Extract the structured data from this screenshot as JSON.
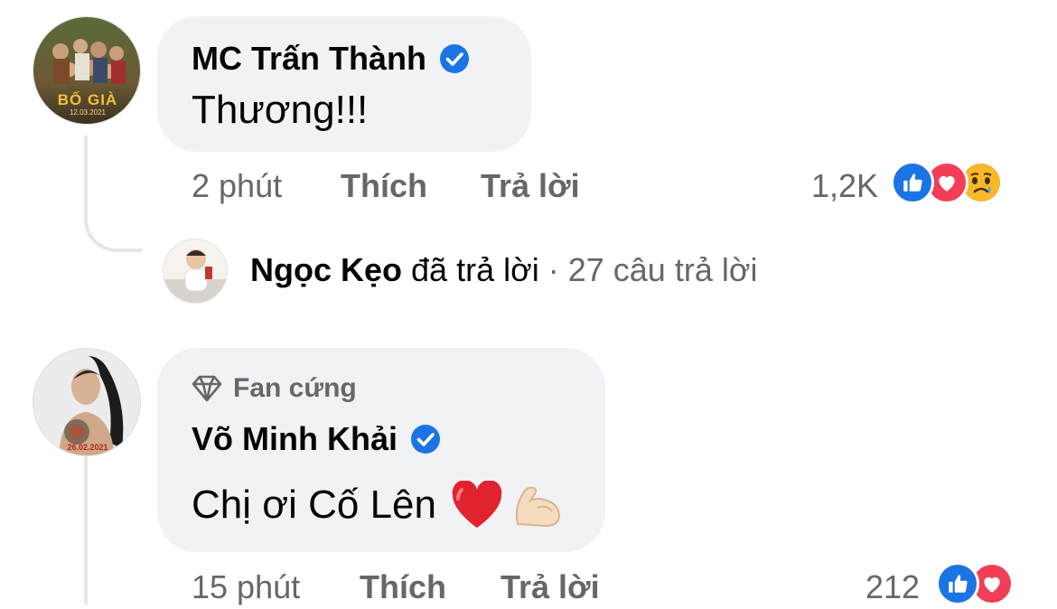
{
  "comments": [
    {
      "author": "MC Trấn Thành",
      "text": "Thương!!!",
      "time": "2 phút",
      "like_label": "Thích",
      "reply_label": "Trả lời",
      "reaction_count": "1,2K",
      "reactions": [
        "like-icon",
        "love-icon",
        "sad-icon"
      ],
      "avatar_text": {
        "title": "BỐ GIÀ",
        "date": "12.03.2021"
      }
    },
    {
      "badge": "Fan cứng",
      "author": "Võ Minh Khải",
      "text": "Chị ơi Cố Lên",
      "emoji": [
        "red-heart",
        "flexed-biceps"
      ],
      "time": "15 phút",
      "like_label": "Thích",
      "reply_label": "Trả lời",
      "reaction_count": "212",
      "reactions": [
        "like-icon",
        "love-icon"
      ],
      "avatar_text": {
        "date": "26.02.2021"
      }
    }
  ],
  "reply_summary": {
    "author": "Ngọc Kẹo",
    "action": "đã trả lời",
    "separator": "·",
    "count_text": "27 câu trả lời"
  },
  "colors": {
    "bubble": "#f0f2f5",
    "secondary_text": "#65676b",
    "like_blue": "#1b74e4",
    "love_red": "#f33e58",
    "verified_blue": "#1b74e4"
  }
}
